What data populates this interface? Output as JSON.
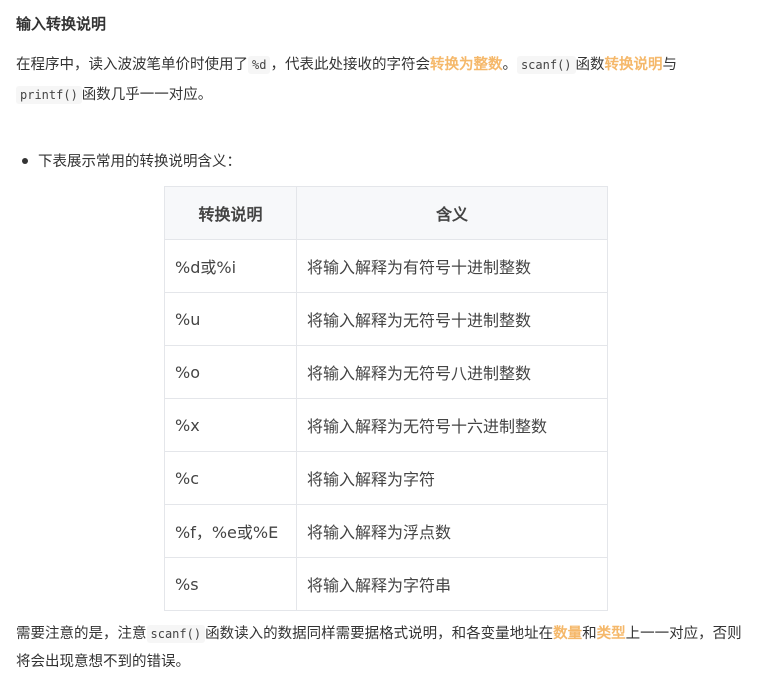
{
  "heading": "输入转换说明",
  "para1": {
    "t1": "在程序中，读入波波笔单价时使用了",
    "code1": "%d",
    "t2": "，代表此处接收的字符会",
    "hl1": "转换为整数",
    "t3": "。",
    "code2": "scanf()",
    "t4": "函数",
    "hl2": "转换说明",
    "t5": "与",
    "code3": "printf()",
    "t6": "函数几乎一一对应。"
  },
  "bullet": "下表展示常用的转换说明含义：",
  "table": {
    "headers": [
      "转换说明",
      "含义"
    ],
    "rows": [
      [
        "%d或%i",
        "将输入解释为有符号十进制整数"
      ],
      [
        "%u",
        "将输入解释为无符号十进制整数"
      ],
      [
        "%o",
        "将输入解释为无符号八进制整数"
      ],
      [
        "%x",
        "将输入解释为无符号十六进制整数"
      ],
      [
        "%c",
        "将输入解释为字符"
      ],
      [
        "%f，%e或%E",
        "将输入解释为浮点数"
      ],
      [
        "%s",
        "将输入解释为字符串"
      ]
    ]
  },
  "para2": {
    "t1": "需要注意的是，注意",
    "code1": "scanf()",
    "t2": "函数读入的数据同样需要据格式说明，和各变量地址在",
    "hl1": "数量",
    "t3": "和",
    "hl2": "类型",
    "t4": "上一一对应，否则将会出现意想不到的错误。"
  },
  "colors": {
    "highlight": "#f5b86a"
  }
}
